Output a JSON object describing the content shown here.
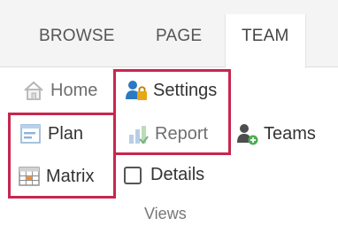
{
  "tabs": [
    {
      "label": "BROWSE"
    },
    {
      "label": "PAGE"
    },
    {
      "label": "TEAM",
      "selected": true
    }
  ],
  "ribbon": {
    "home_label": "Home",
    "settings_label": "Settings",
    "plan_label": "Plan",
    "report_label": "Report",
    "teams_label": "Teams",
    "matrix_label": "Matrix",
    "details_label": "Details",
    "details_checked": false,
    "group_label": "Views"
  },
  "colors": {
    "highlight": "#c8264e",
    "accent_blue": "#2b79c2",
    "lock_gold": "#e6a817",
    "report_green": "#78b07f"
  }
}
